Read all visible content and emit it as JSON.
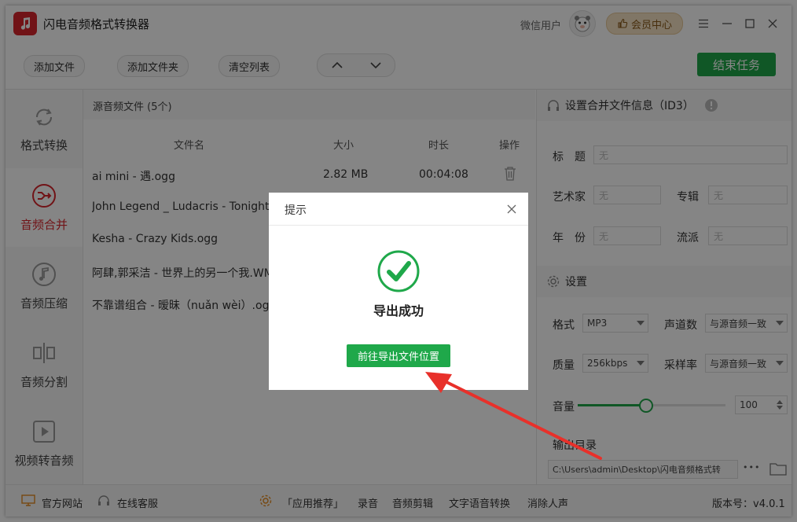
{
  "app": {
    "title": "闪电音频格式转换器",
    "user_name": "微信用户",
    "vip_label": "会员中心"
  },
  "toolbar": {
    "add_file": "添加文件",
    "add_folder": "添加文件夹",
    "clear_list": "清空列表",
    "end_task": "结束任务"
  },
  "sidebar": {
    "items": [
      {
        "label": "格式转换",
        "icon": "refresh-icon"
      },
      {
        "label": "音频合并",
        "icon": "merge-icon"
      },
      {
        "label": "音频压缩",
        "icon": "music-note-icon"
      },
      {
        "label": "音频分割",
        "icon": "split-icon"
      },
      {
        "label": "视频转音频",
        "icon": "video-icon"
      }
    ]
  },
  "file_list": {
    "title": "源音频文件 (5个)",
    "columns": {
      "name": "文件名",
      "size": "大小",
      "duration": "时长",
      "action": "操作"
    },
    "rows": [
      {
        "name": "ai mini - 遇.ogg",
        "size": "2.82 MB",
        "duration": "00:04:08"
      },
      {
        "name": "John Legend _ Ludacris - Tonight",
        "size": "",
        "duration": ""
      },
      {
        "name": "Kesha - Crazy Kids.ogg",
        "size": "",
        "duration": ""
      },
      {
        "name": "阿肆,郭采洁 - 世界上的另一个我.WM",
        "size": "",
        "duration": ""
      },
      {
        "name": "不靠谱组合 - 暧昧（nuǎn wèi）.ogg",
        "size": "",
        "duration": ""
      }
    ]
  },
  "id3": {
    "section_title": "设置合并文件信息（ID3）",
    "title_label": "标　题",
    "artist_label": "艺术家",
    "album_label": "专辑",
    "year_label": "年　份",
    "genre_label": "流派",
    "placeholder": "无"
  },
  "settings": {
    "section_title": "设置",
    "format_label": "格式",
    "format_value": "MP3",
    "channels_label": "声道数",
    "channels_value": "与源音频一致",
    "quality_label": "质量",
    "quality_value": "256kbps",
    "samplerate_label": "采样率",
    "samplerate_value": "与源音频一致",
    "volume_label": "音量",
    "volume_value": "100",
    "volume_percent": 46,
    "output_label": "输出目录",
    "output_path": "C:\\Users\\admin\\Desktop\\闪电音频格式转",
    "more_label": "•••"
  },
  "statusbar": {
    "website": "官方网站",
    "service": "在线客服",
    "recommend": "「应用推荐」",
    "record": "录音",
    "edit": "音频剪辑",
    "tts": "文字语音转换",
    "vocal": "消除人声",
    "version": "版本号：v4.0.1"
  },
  "dialog": {
    "title": "提示",
    "message": "导出成功",
    "button": "前往导出文件位置"
  },
  "colors": {
    "accent_green": "#1fa84a",
    "brand_red": "#d8262c",
    "annotation_red": "#e8302a"
  }
}
